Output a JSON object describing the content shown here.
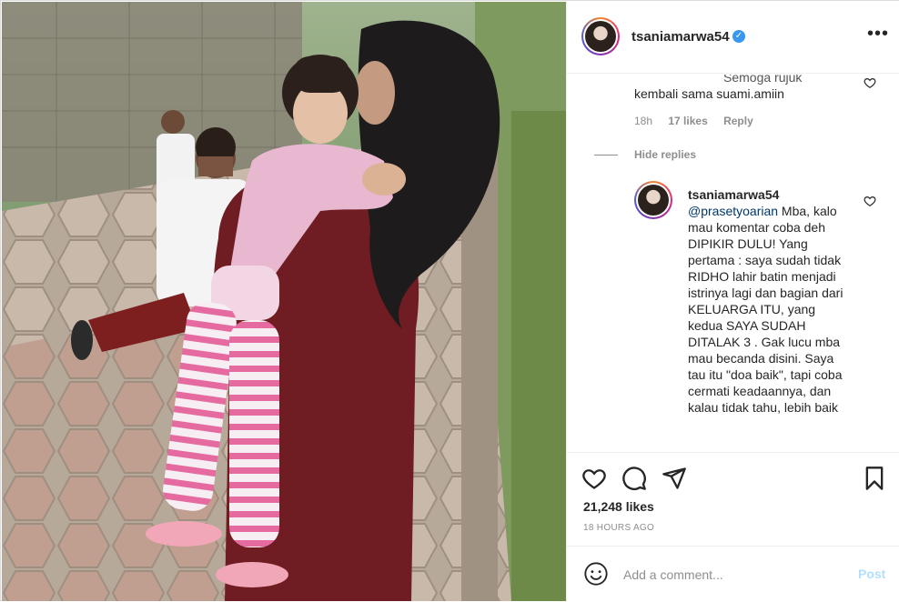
{
  "post": {
    "username": "tsaniamarwa54",
    "verified": true,
    "image_alt": "photo",
    "likes": "21,248 likes",
    "timestamp": "18 HOURS AGO"
  },
  "comments": {
    "first": {
      "text_line1": "Semoga rujuk",
      "text_line2": "kembali sama suami.amiin",
      "age": "18h",
      "likes": "17 likes",
      "reply_label": "Reply"
    },
    "hide_replies": "Hide replies",
    "reply": {
      "username": "tsaniamarwa54",
      "mention": "@prasetyoarian",
      "text": " Mba, kalo mau komentar coba deh DIPIKIR DULU! Yang pertama : saya sudah tidak RIDHO lahir batin menjadi istrinya lagi dan bagian dari KELUARGA ITU, yang kedua SAYA SUDAH DITALAK 3 . Gak lucu mba mau becanda disini. Saya tau itu \"doa baik\", tapi coba cermati keadaannya, dan kalau tidak tahu, lebih baik"
    }
  },
  "composer": {
    "placeholder": "Add a comment...",
    "post_label": "Post"
  },
  "colors": {
    "accent": "#3897f0",
    "post_disabled": "#b2dffc",
    "muted": "#8e8e8e"
  },
  "icons": [
    "more-icon",
    "like-heart-icon",
    "comment-icon",
    "share-icon",
    "save-bookmark-icon",
    "emoji-icon",
    "verified-badge-icon"
  ]
}
